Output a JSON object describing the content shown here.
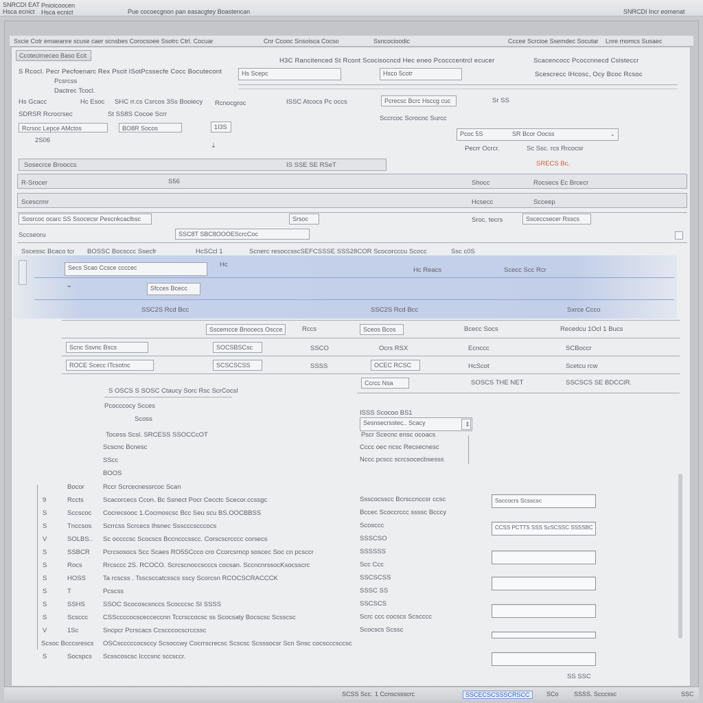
{
  "window": {
    "tl1": "SNRCDI EAT",
    "tl2": "Hsca ecnict",
    "tl3": "Pnioicoocen",
    "tc": "Pue cocoecgnon pan easacgtey Boastencan",
    "tr": "SNRCDI Incr eomenat"
  },
  "menubar": [
    "Sscie Cotr emaeanre scuse caer scnsbes Corocsoee Ssotrc Ctrl. Cocuar",
    "Cnr Ccooc Snsoisca Cocso",
    "Ssncocioodic",
    "Cccee Scrcioe Ssemdec Socutar",
    "Lnre rnomcs Susaec"
  ],
  "header": {
    "section": "Ccotecirneceo Baso Ecit",
    "line1": "S Rcocl. Pecr Pecfoenarc Rex Pscit ISotPcssecfe Cocc Bocutecont",
    "line1b": "Pcsrcss",
    "line1c": "Dactrec Tcocl.",
    "center1": "H3C Rancitenced St Rcont Scocisocncd Hec eneo Pcocccentrcl ecucer",
    "right1": "Scacencocc Pcoccnnecd Csisteccr",
    "fld1": "Hs Scepc",
    "fld2": "Hsco 5cotr",
    "right2": "Scescrecc IHcosc, Ocy Bcoc Rcsoc"
  },
  "formA": {
    "l1": "Hs Gcacc",
    "l2": "Hc Esoc",
    "l3": "SHC rr.cs Csrcos 3Ss Booiecy",
    "l4": "Rcnocgroc",
    "l5": "ISSC Atcocs Pc occs",
    "l6": "Pcrecsc Bcrc Hsccg cuc",
    "l7": "Sr SS",
    "l8": "SDRSR Rcrocrsec",
    "l9": "St SS8S Cocoe Scrr",
    "l10": "Rcrsoc Lepce AMctos",
    "l11": "BO8R Socos",
    "l12": "1I3S",
    "l13": "Sccrcoc Scrocnc Surcc",
    "l14": "2S06",
    "l15": "Pcoc 5S",
    "l16": "SR Bcor Oocss",
    "l17": "Pecrr Ocrcr.",
    "l18": "Sc Ssc. rcs Rrcocsr",
    "l19": "SRECS Bc."
  },
  "rows": {
    "r1a": "Sosecrce Brooccs",
    "r1b": "IS SSE SE RSeT",
    "r2a": "R-Srocer",
    "r2b": "S56",
    "r2c": "Shocc",
    "r2d": "Rocsecs Ec Brcecr",
    "r3a": "Scescrmr",
    "r3b": "Hcsecc",
    "r3c": "Scceep",
    "r4a": "Sosrcoc ocarc SS Ssocecsr Pescnkcaclbsc",
    "r4b": "Srsoc",
    "r4c": "Sroc. tecrs",
    "r4d": "Ssceccsecer Rsscs",
    "r5a": "Sccseoru",
    "r5b": "SSC8T SBC8OOOEScrcCoc",
    "r6a": "Sscessc Bcaco tcr",
    "r6b": "BOSSC Bocsccc Ssecfr",
    "r6c": "HcSCcl 1",
    "r6d": "Scnerc resoccsscSEFCSSSE SSS28COR Scocorcccu Scocc",
    "r6e": "Ssc c0S"
  },
  "blue": {
    "f1": "Secs Scao Ccsce ccccec",
    "f2": "Hc",
    "f3": "Hc Reacs",
    "f4": "Scecc Scc Rcr",
    "f5": "Sfcces Bcecc",
    "f6": "SSC2S Rcd Bcc",
    "f7": "Sxrce Ccco"
  },
  "grid": {
    "h1": "Sscemcce Bnocecs Oscce",
    "h2": "Rccs",
    "h3": "Sceos Bcos",
    "h4": "Bcecc Socs",
    "h5": "Recedcu 1Ocl 1 Bucs",
    "a1": "Scnc Ssvnc Bscs",
    "a2": "SOCSBSCsc",
    "a3": "SSCO",
    "a4": "Ocrs RSX",
    "a5": "Ecnccc",
    "a6": "SCBoccr",
    "b1": "ROCE Scecc ITcsotnc",
    "b2": "SCSCSCSS",
    "b3": "SSSS",
    "b4": "OCEC RCSC",
    "b5": "HcScot",
    "b6": "Scetcu rcw",
    "c1": "Ccrcc Nsa",
    "c2": "SOSCS THE NET",
    "c3": "SSCSCS SE BDCCIR."
  },
  "detail": {
    "d1": "S OSCS  S SOSC Ctaucy Sorc Rsc ScrCocsl",
    "d2": "Pcocccocy Scces",
    "d3": "Scoss",
    "d4": "Tocess Scsl. SRCESS SSOCCcOT",
    "d5": "Scscnc  Bcnesc",
    "d6": "SScc",
    "d7": "BOOS",
    "e1": "ISSS Scocoo BS1",
    "e2": "Sesnsecrsstec.. Scacy",
    "e3": "Pscr Scecnc ensc ocoacs",
    "e4": "Cccc oec ncsc Recsecnesc",
    "e5": "Nccc pcscc scrcsocecbsesss"
  },
  "list": [
    {
      "n": "",
      "a": "Bocor",
      "b": "Rccr  Scrcecnessrcoc Scan"
    },
    {
      "n": "9",
      "a": "Rccts",
      "b": "Scacorcecs Ccon.  Bc Ssnect Pocr Cecctc Scecor.ccssgc"
    },
    {
      "n": "S",
      "a": "Sccscoc",
      "b": "Cocrecsooc 1.Cocmoscsc Bcc Seu scu BS.OOCBBSS"
    },
    {
      "n": "S",
      "a": "Tnccsos",
      "b": "Scrrcss   Scrcecs Ihsnec Ssscccscccocs"
    },
    {
      "n": "V",
      "a": "SOLBS..",
      "b": "Sc occccsc Scocscs Bccncccsscc.  Corscscrcccc corsecs"
    },
    {
      "n": "S",
      "a": "SSBCR",
      "b": "Pcrcsosocs Scc Scaes RO5SCcco cro Ccorcsrncp soscec Soc cn pcsccr"
    },
    {
      "n": "S",
      "a": "Rocs",
      "b": "Rrcsccc 2S. RCOCO. Scrcscnoccscccs cocsan.  SccncnrssocKsocsscrc"
    },
    {
      "n": "S",
      "a": "HOSS",
      "b": "Ta rcscss .  Tsscsccatcsscs sscy Scorcsn RCOCSCRACCCK"
    },
    {
      "n": "S",
      "a": "T",
      "b": "Pcscss"
    },
    {
      "n": "S",
      "a": "SSHS",
      "b": "SSOC  Scocoscsnccs Scocccsc SI SSSS"
    },
    {
      "n": "S",
      "a": "Scsccc",
      "b": "CSSccccocscecceccnn Tccrsccocsc ss Scocsaty Bocscsc Scsscsc"
    },
    {
      "n": "V",
      "a": "1Sc",
      "b": "Sncpcr Pcrscacs Ccscccocscrccssc"
    },
    {
      "n": "Scsoc Bcccsrescs",
      "a": "",
      "b": "OSCscccccocsccy Scsoccwy Cocrrscrecsc Scscsc Scsssocsr Scn Snsc cocscccsccsc"
    },
    {
      "n": "S",
      "a": "Socspcs",
      "b": "Scsscoscsc Icccsnc sccsccr."
    }
  ],
  "side": [
    "Ssscocsscc Bcrsccnccsr ccsc",
    "Bccec Scoccrccc ssssc Bcccy",
    "Scosccc",
    "SSSCSO",
    "SSSSSS",
    "Scc Ccc",
    "SSCSCSS",
    "SSSC SS",
    "SSCSCS",
    "Scrc ccc cocscs Scscccc",
    "Scocscs Scssc"
  ],
  "side_inputs": {
    "i1": "Ssccocrs Scsscsc",
    "i2": "CCSS PCTTS SSS ScSCSSC SSSSBC"
  },
  "status": {
    "s1": "SCSS Scc.",
    "s2": "1 Ccnscssscrc",
    "s3": "SSCECSCSSSCRSCC",
    "s4": "SCo",
    "s5": "SSSS. Scccssc",
    "s6": "SSC"
  },
  "footer_small": "SS SSC",
  "colors": {
    "accent": "#2f5fbf",
    "band": "#c3cfe9",
    "alert": "#d25a3a"
  }
}
